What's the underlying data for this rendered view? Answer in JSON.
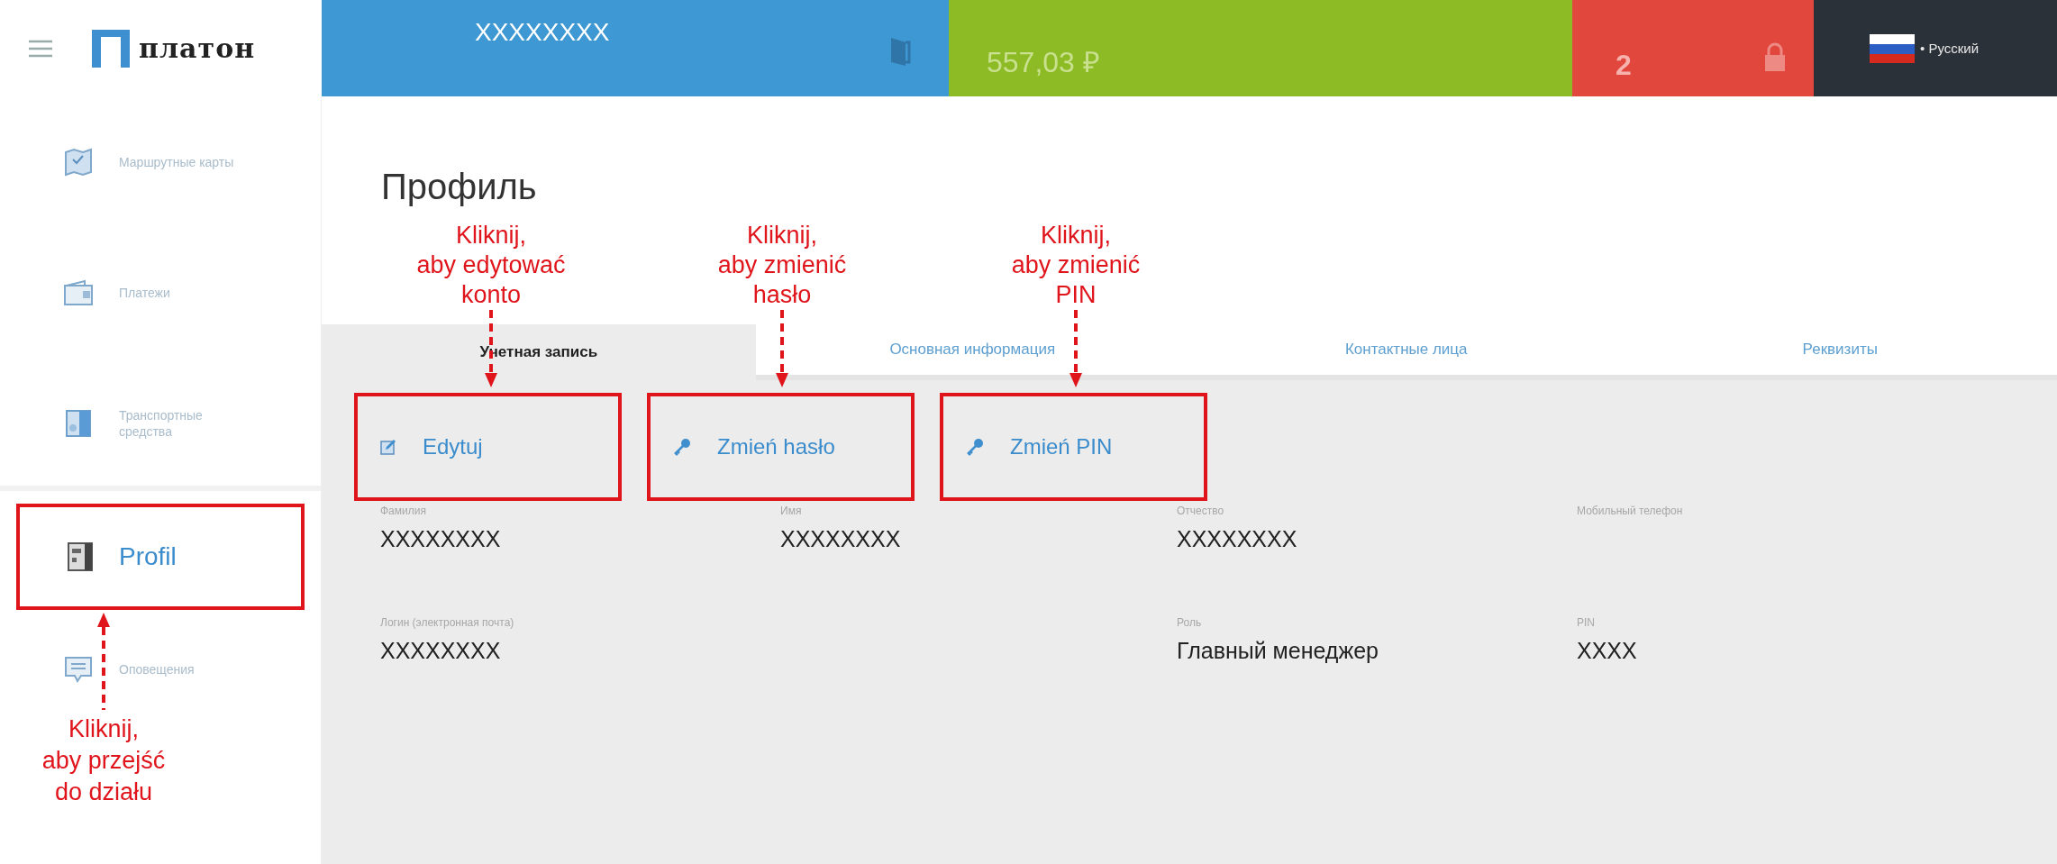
{
  "logo": {
    "text": "платон"
  },
  "topbar": {
    "account": "XXXXXXXX",
    "balance": "557,03 ₽",
    "alerts": "2",
    "language": "• Русский"
  },
  "sidebar": {
    "items": [
      {
        "label": "Маршрутные карты",
        "selected": false,
        "kind": "route"
      },
      {
        "label": "Платежи",
        "selected": false,
        "kind": "wallet"
      },
      {
        "label": "Транспортные средства",
        "selected": false,
        "kind": "truck"
      },
      {
        "label": "Profil",
        "selected": true,
        "kind": "profile",
        "highlight": true,
        "note": [
          "Kliknij,",
          "aby przejść",
          "do działu"
        ]
      },
      {
        "label": "Оповещения",
        "selected": false,
        "kind": "chat"
      }
    ]
  },
  "page_title": "Профиль",
  "tabs": [
    {
      "label": "Учетная запись",
      "selected": true
    },
    {
      "label": "Основная информация",
      "selected": false
    },
    {
      "label": "Контактные лица",
      "selected": false
    },
    {
      "label": "Реквизиты",
      "selected": false
    }
  ],
  "actions": [
    {
      "label": "Edytuj",
      "kind": "edit",
      "note": [
        "Kliknij,",
        "aby edytować",
        "konto"
      ]
    },
    {
      "label": "Zmień hasło",
      "kind": "key",
      "note": [
        "Kliknij,",
        "aby zmienić",
        "hasło"
      ]
    },
    {
      "label": "Zmień PIN",
      "kind": "key",
      "note": [
        "Kliknij,",
        "aby zmienić",
        "PIN"
      ]
    }
  ],
  "fields": [
    {
      "label": "Фамилия",
      "value": "XXXXXXXX"
    },
    {
      "label": "Имя",
      "value": "XXXXXXXX"
    },
    {
      "label": "Отчество",
      "value": "XXXXXXXX"
    },
    {
      "label": "Мобильный телефон"
    },
    {
      "label": "Логин (электронная почта)",
      "value": "XXXXXXXX"
    },
    {
      "label": "Роль",
      "value": "Главный менеджер"
    },
    {
      "label": "PIN",
      "value": "XXXX"
    }
  ]
}
